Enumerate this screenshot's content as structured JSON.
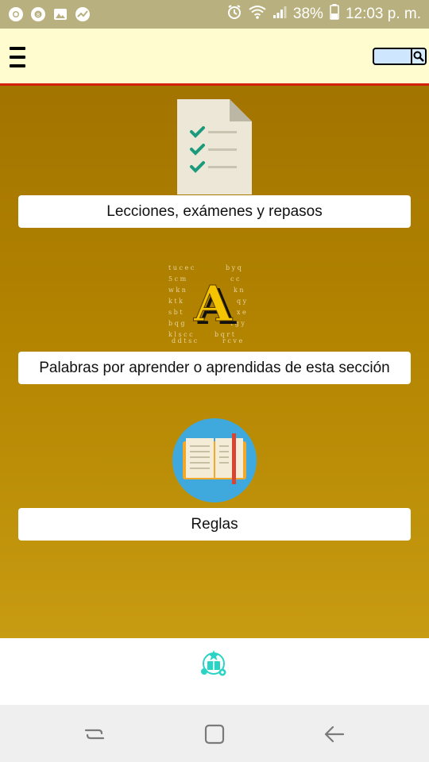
{
  "status_bar": {
    "left_icons": [
      "chrome-icon",
      "eight-ball-icon",
      "gallery-icon",
      "analytics-icon"
    ],
    "right_icons": [
      "alarm-icon",
      "wifi-icon",
      "signal-icon",
      "battery-icon"
    ],
    "battery": "38%",
    "time": "12:03 p. m."
  },
  "app_bar": {
    "menu_icon": "hamburger-icon",
    "search": {
      "value": "",
      "placeholder": "",
      "icon": "search-icon"
    }
  },
  "menu": {
    "items": [
      {
        "label": "Lecciones, exámenes y repasos",
        "icon": "checklist-document-icon"
      },
      {
        "label": "Palabras por aprender o aprendidas de esta sección",
        "icon": "letter-a-icon"
      },
      {
        "label": "Reglas",
        "icon": "open-book-icon"
      }
    ]
  },
  "bottom": {
    "icon": "learning-settings-icon"
  },
  "nav_bar": {
    "icons": [
      "recent-apps-icon",
      "home-icon",
      "back-icon"
    ]
  },
  "colors": {
    "status_bar": "#b9b07f",
    "app_bar": "#fffdd0",
    "app_bar_border": "#d2220f",
    "main_gradient_top": "#a27400",
    "main_gradient_bottom": "#c79b12",
    "accent_teal": "#2bd3c4"
  }
}
